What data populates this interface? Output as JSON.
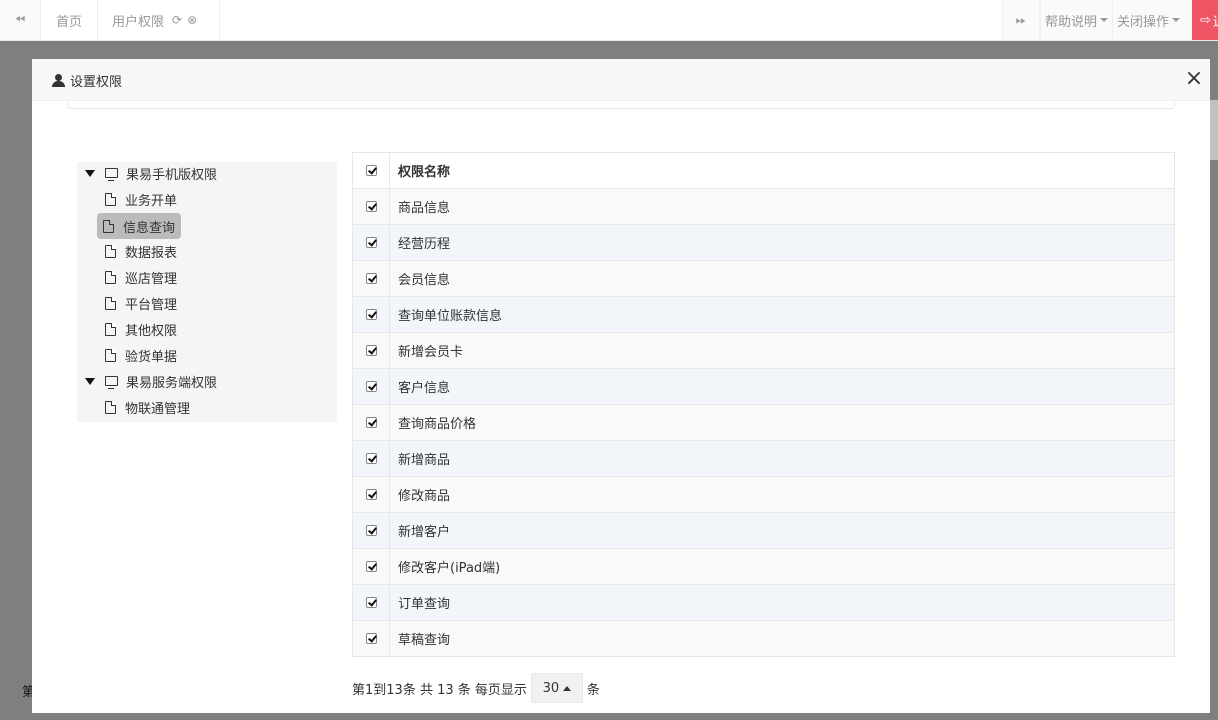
{
  "topbar": {
    "tabs": [
      {
        "label": "首页"
      },
      {
        "label": "用户权限"
      }
    ],
    "help_label": "帮助说明",
    "close_ops_label": "关闭操作",
    "logout_label": "退"
  },
  "background": {
    "pager_fragment": "第"
  },
  "modal": {
    "title": "设置权限",
    "close_symbol": "×"
  },
  "tree": {
    "groups": [
      {
        "label": "果易手机版权限",
        "children": [
          "业务开单",
          "信息查询",
          "数据报表",
          "巡店管理",
          "平台管理",
          "其他权限",
          "验货单据"
        ]
      },
      {
        "label": "果易服务端权限",
        "children": [
          "物联通管理"
        ]
      }
    ],
    "selected": "信息查询"
  },
  "table": {
    "header": "权限名称",
    "rows": [
      {
        "name": "商品信息",
        "checked": true
      },
      {
        "name": "经营历程",
        "checked": true
      },
      {
        "name": "会员信息",
        "checked": true
      },
      {
        "name": "查询单位账款信息",
        "checked": true
      },
      {
        "name": "新增会员卡",
        "checked": true
      },
      {
        "name": "客户信息",
        "checked": true
      },
      {
        "name": "查询商品价格",
        "checked": true
      },
      {
        "name": "新增商品",
        "checked": true
      },
      {
        "name": "修改商品",
        "checked": true
      },
      {
        "name": "新增客户",
        "checked": true
      },
      {
        "name": "修改客户(iPad端)",
        "checked": true
      },
      {
        "name": "订单查询",
        "checked": true
      },
      {
        "name": "草稿查询",
        "checked": true
      }
    ]
  },
  "pager": {
    "summary": "第1到13条 共 13 条 每页显示",
    "page_size": "30",
    "suffix": "条"
  }
}
